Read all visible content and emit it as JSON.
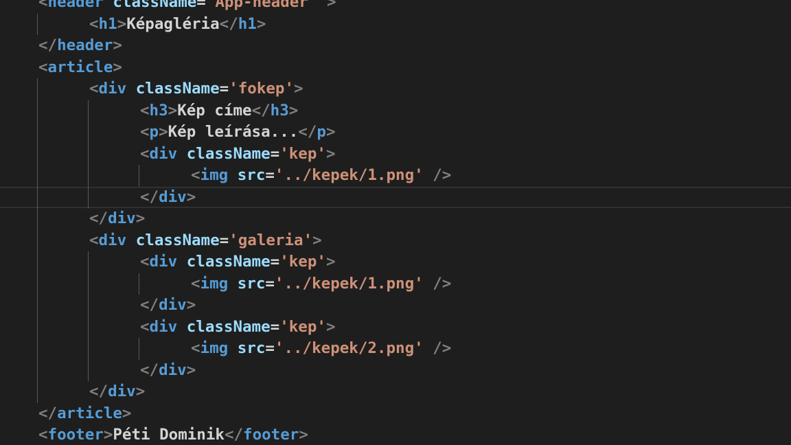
{
  "editor": {
    "language": "jsx",
    "theme": "dark",
    "lines": [
      {
        "indent": 1,
        "tokens": [
          {
            "t": "b",
            "v": "<"
          },
          {
            "t": "n",
            "v": "header"
          },
          {
            "t": "x",
            "v": " "
          },
          {
            "t": "a",
            "v": "className"
          },
          {
            "t": "e",
            "v": "="
          },
          {
            "t": "s",
            "v": "'App-header'"
          },
          {
            "t": "x",
            "v": " "
          },
          {
            "t": "b",
            "v": ">"
          }
        ]
      },
      {
        "indent": 2,
        "tokens": [
          {
            "t": "b",
            "v": "<"
          },
          {
            "t": "n",
            "v": "h1"
          },
          {
            "t": "b",
            "v": ">"
          },
          {
            "t": "x",
            "v": "Képagléria"
          },
          {
            "t": "b",
            "v": "</"
          },
          {
            "t": "n",
            "v": "h1"
          },
          {
            "t": "b",
            "v": ">"
          }
        ]
      },
      {
        "indent": 1,
        "tokens": [
          {
            "t": "b",
            "v": "</"
          },
          {
            "t": "n",
            "v": "header"
          },
          {
            "t": "b",
            "v": ">"
          }
        ]
      },
      {
        "indent": 1,
        "tokens": [
          {
            "t": "b",
            "v": "<"
          },
          {
            "t": "n",
            "v": "article"
          },
          {
            "t": "b",
            "v": ">"
          }
        ]
      },
      {
        "indent": 2,
        "tokens": [
          {
            "t": "b",
            "v": "<"
          },
          {
            "t": "n",
            "v": "div"
          },
          {
            "t": "x",
            "v": " "
          },
          {
            "t": "a",
            "v": "className"
          },
          {
            "t": "e",
            "v": "="
          },
          {
            "t": "s",
            "v": "'fokep'"
          },
          {
            "t": "b",
            "v": ">"
          }
        ]
      },
      {
        "indent": 3,
        "tokens": [
          {
            "t": "b",
            "v": "<"
          },
          {
            "t": "n",
            "v": "h3"
          },
          {
            "t": "b",
            "v": ">"
          },
          {
            "t": "x",
            "v": "Kép címe"
          },
          {
            "t": "b",
            "v": "</"
          },
          {
            "t": "n",
            "v": "h3"
          },
          {
            "t": "b",
            "v": ">"
          }
        ]
      },
      {
        "indent": 3,
        "tokens": [
          {
            "t": "b",
            "v": "<"
          },
          {
            "t": "n",
            "v": "p"
          },
          {
            "t": "b",
            "v": ">"
          },
          {
            "t": "x",
            "v": "Kép leírása..."
          },
          {
            "t": "b",
            "v": "</"
          },
          {
            "t": "n",
            "v": "p"
          },
          {
            "t": "b",
            "v": ">"
          }
        ]
      },
      {
        "indent": 3,
        "tokens": [
          {
            "t": "b",
            "v": "<"
          },
          {
            "t": "n",
            "v": "div"
          },
          {
            "t": "x",
            "v": " "
          },
          {
            "t": "a",
            "v": "className"
          },
          {
            "t": "e",
            "v": "="
          },
          {
            "t": "s",
            "v": "'kep'"
          },
          {
            "t": "b",
            "v": ">"
          }
        ]
      },
      {
        "indent": 4,
        "tokens": [
          {
            "t": "b",
            "v": "<"
          },
          {
            "t": "n",
            "v": "img"
          },
          {
            "t": "x",
            "v": " "
          },
          {
            "t": "a",
            "v": "src"
          },
          {
            "t": "e",
            "v": "="
          },
          {
            "t": "s",
            "v": "'../kepek/1.png'"
          },
          {
            "t": "x",
            "v": " "
          },
          {
            "t": "b",
            "v": "/>"
          }
        ]
      },
      {
        "indent": 3,
        "active": true,
        "tokens": [
          {
            "t": "b",
            "v": "</"
          },
          {
            "t": "n",
            "v": "div"
          },
          {
            "t": "b",
            "v": ">"
          }
        ]
      },
      {
        "indent": 2,
        "tokens": [
          {
            "t": "b",
            "v": "</"
          },
          {
            "t": "n",
            "v": "div"
          },
          {
            "t": "b",
            "v": ">"
          }
        ]
      },
      {
        "indent": 2,
        "tokens": [
          {
            "t": "b",
            "v": "<"
          },
          {
            "t": "n",
            "v": "div"
          },
          {
            "t": "x",
            "v": " "
          },
          {
            "t": "a",
            "v": "className"
          },
          {
            "t": "e",
            "v": "="
          },
          {
            "t": "s",
            "v": "'galeria'"
          },
          {
            "t": "b",
            "v": ">"
          }
        ]
      },
      {
        "indent": 3,
        "tokens": [
          {
            "t": "b",
            "v": "<"
          },
          {
            "t": "n",
            "v": "div"
          },
          {
            "t": "x",
            "v": " "
          },
          {
            "t": "a",
            "v": "className"
          },
          {
            "t": "e",
            "v": "="
          },
          {
            "t": "s",
            "v": "'kep'"
          },
          {
            "t": "b",
            "v": ">"
          }
        ]
      },
      {
        "indent": 4,
        "tokens": [
          {
            "t": "b",
            "v": "<"
          },
          {
            "t": "n",
            "v": "img"
          },
          {
            "t": "x",
            "v": " "
          },
          {
            "t": "a",
            "v": "src"
          },
          {
            "t": "e",
            "v": "="
          },
          {
            "t": "s",
            "v": "'../kepek/1.png'"
          },
          {
            "t": "x",
            "v": " "
          },
          {
            "t": "b",
            "v": "/>"
          }
        ]
      },
      {
        "indent": 3,
        "tokens": [
          {
            "t": "b",
            "v": "</"
          },
          {
            "t": "n",
            "v": "div"
          },
          {
            "t": "b",
            "v": ">"
          }
        ]
      },
      {
        "indent": 3,
        "tokens": [
          {
            "t": "b",
            "v": "<"
          },
          {
            "t": "n",
            "v": "div"
          },
          {
            "t": "x",
            "v": " "
          },
          {
            "t": "a",
            "v": "className"
          },
          {
            "t": "e",
            "v": "="
          },
          {
            "t": "s",
            "v": "'kep'"
          },
          {
            "t": "b",
            "v": ">"
          }
        ]
      },
      {
        "indent": 4,
        "tokens": [
          {
            "t": "b",
            "v": "<"
          },
          {
            "t": "n",
            "v": "img"
          },
          {
            "t": "x",
            "v": " "
          },
          {
            "t": "a",
            "v": "src"
          },
          {
            "t": "e",
            "v": "="
          },
          {
            "t": "s",
            "v": "'../kepek/2.png'"
          },
          {
            "t": "x",
            "v": " "
          },
          {
            "t": "b",
            "v": "/>"
          }
        ]
      },
      {
        "indent": 3,
        "tokens": [
          {
            "t": "b",
            "v": "</"
          },
          {
            "t": "n",
            "v": "div"
          },
          {
            "t": "b",
            "v": ">"
          }
        ]
      },
      {
        "indent": 2,
        "tokens": [
          {
            "t": "b",
            "v": "</"
          },
          {
            "t": "n",
            "v": "div"
          },
          {
            "t": "b",
            "v": ">"
          }
        ]
      },
      {
        "indent": 1,
        "tokens": [
          {
            "t": "b",
            "v": "</"
          },
          {
            "t": "n",
            "v": "article"
          },
          {
            "t": "b",
            "v": ">"
          }
        ]
      },
      {
        "indent": 1,
        "tokens": [
          {
            "t": "b",
            "v": "<"
          },
          {
            "t": "n",
            "v": "footer"
          },
          {
            "t": "b",
            "v": ">"
          },
          {
            "t": "x",
            "v": "Péti Dominik"
          },
          {
            "t": "b",
            "v": "</"
          },
          {
            "t": "n",
            "v": "footer"
          },
          {
            "t": "b",
            "v": ">"
          }
        ]
      }
    ]
  },
  "colors": {
    "background": "#1e1e1e",
    "tag_bracket": "#808080",
    "tag_name": "#569cd6",
    "attr_name": "#9cdcfe",
    "attr_value": "#ce9178",
    "text": "#d4d4d4",
    "indent_guide": "#5a5a5a",
    "active_indent_guide": "#9a9a9a",
    "active_line_border": "#303030"
  }
}
